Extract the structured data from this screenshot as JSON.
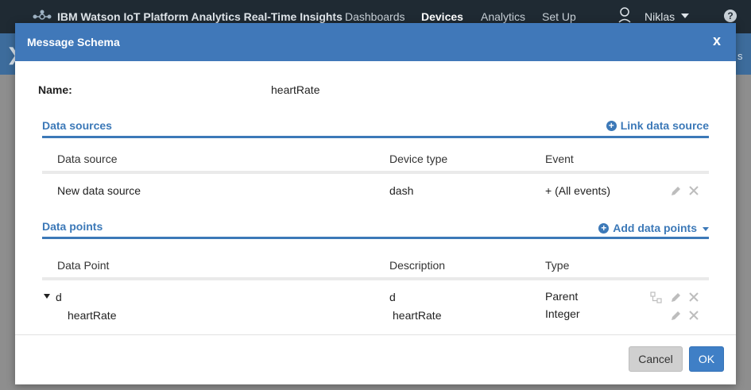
{
  "app": {
    "brand": "IBM Watson IoT Platform Analytics Real-Time Insights",
    "nav": [
      "Dashboards",
      "Devices",
      "Analytics",
      "Set Up"
    ],
    "active_nav": "Devices",
    "user": "Niklas",
    "help": "?",
    "subbar_cut_text": "s"
  },
  "modal": {
    "title": "Message Schema",
    "close": "x",
    "name_label": "Name:",
    "name_value": "heartRate",
    "data_sources": {
      "title": "Data sources",
      "action": "Link data source",
      "columns": [
        "Data source",
        "Device type",
        "Event"
      ],
      "rows": [
        {
          "data_source": "New data source",
          "device_type": "dash",
          "event": "+ (All events)"
        }
      ]
    },
    "data_points": {
      "title": "Data points",
      "action": "Add data points",
      "columns": [
        "Data Point",
        "Description",
        "Type"
      ],
      "rows": [
        {
          "point": "d",
          "description": "d",
          "type": "Parent"
        },
        {
          "point": "heartRate",
          "description": "heartRate",
          "type": "Integer"
        }
      ]
    },
    "buttons": {
      "cancel": "Cancel",
      "ok": "OK"
    }
  },
  "colors": {
    "accent": "#4078b9",
    "topbar": "#1f2a33",
    "ok_button": "#3f7fc6"
  }
}
